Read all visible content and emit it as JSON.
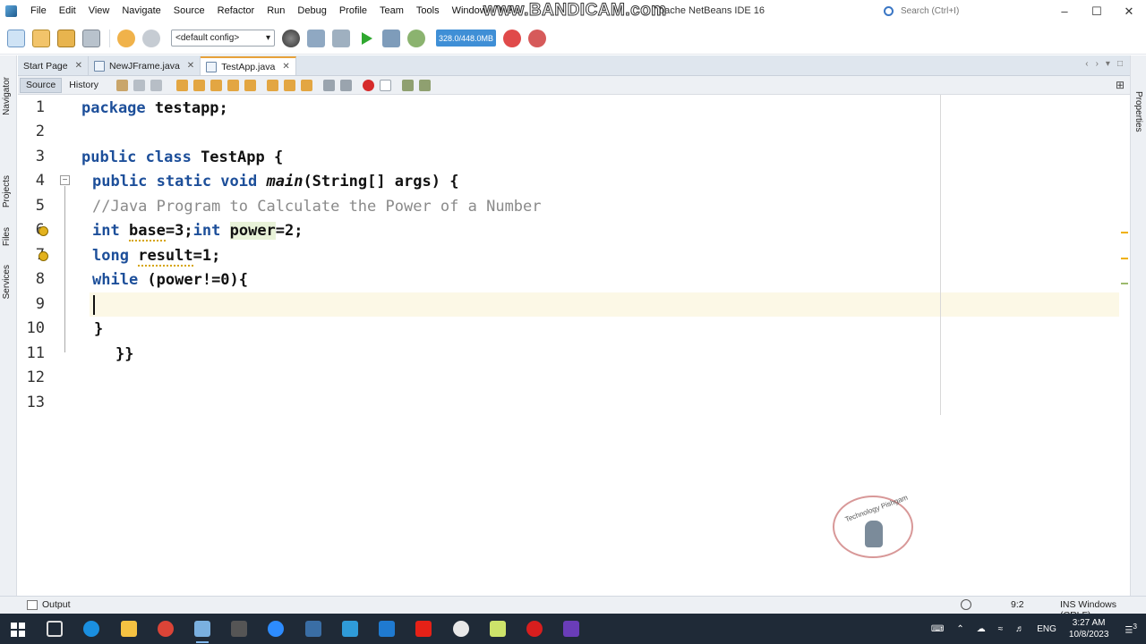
{
  "menu": [
    "File",
    "Edit",
    "View",
    "Navigate",
    "Source",
    "Refactor",
    "Run",
    "Debug",
    "Profile",
    "Team",
    "Tools",
    "Window",
    "Help"
  ],
  "watermark": "www.BANDICAM.com",
  "window_title": "pache NetBeans IDE 16",
  "search": {
    "placeholder": "Search (Ctrl+I)"
  },
  "window_controls": {
    "minimize": "–",
    "maximize": "☐",
    "close": "✕"
  },
  "toolbar": {
    "config_value": "<default config>",
    "memory": "328.0/448.0MB"
  },
  "side_panels": {
    "navigator": "Navigator",
    "projects": "Projects",
    "files": "Files",
    "services": "Services",
    "properties": "Properties"
  },
  "tabs": [
    {
      "label": "Start Page",
      "active": false
    },
    {
      "label": "NewJFrame.java",
      "active": false
    },
    {
      "label": "TestApp.java",
      "active": true
    }
  ],
  "editor_bar": {
    "source": "Source",
    "history": "History"
  },
  "code": {
    "line_numbers": [
      "1",
      "2",
      "3",
      "4",
      "5",
      "6",
      "7",
      "8",
      "9",
      "10",
      "11",
      "12",
      "13"
    ],
    "l1_kw": "package",
    "l1_rest": " testapp;",
    "l3_kw": "public class",
    "l3_rest": " TestApp {",
    "l4_kw": "public static void",
    "l4_fn": "main",
    "l4_rest": "(String[] args) {",
    "l5_comment": "//Java Program to Calculate the Power of a Number",
    "l6_kw1": "int",
    "l6_var1": "base",
    "l6_mid": "=3;",
    "l6_kw2": "int",
    "l6_var2": "power",
    "l6_end": "=2;",
    "l7_kw": "long",
    "l7_var": "result",
    "l7_end": "=1;",
    "l8_kw": "while",
    "l8_rest": " (power!=0){",
    "l10": "}",
    "l11": "}}"
  },
  "channel_logo_text": "Technology Pishgam",
  "status": {
    "output": "Output",
    "position": "9:2",
    "mode": "INS Windows (CRLF)"
  },
  "taskbar": {
    "lang": "ENG",
    "time": "3:27 AM",
    "date": "10/8/2023",
    "notifications": "3"
  }
}
